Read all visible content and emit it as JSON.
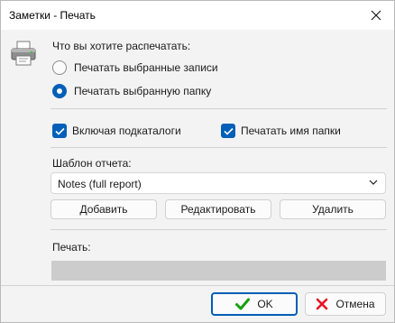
{
  "window": {
    "title": "Заметки - Печать"
  },
  "prompt": "Что вы хотите распечатать:",
  "print_mode": {
    "options": [
      {
        "label": "Печатать выбранные записи",
        "checked": false
      },
      {
        "label": "Печатать выбранную папку",
        "checked": true
      }
    ]
  },
  "options": {
    "include_subfolders": {
      "label": "Включая подкаталоги",
      "checked": true
    },
    "print_folder_name": {
      "label": "Печатать имя папки",
      "checked": true
    }
  },
  "template": {
    "label": "Шаблон отчета:",
    "selected": "Notes (full report)",
    "buttons": {
      "add": "Добавить",
      "edit": "Редактировать",
      "delete": "Удалить"
    }
  },
  "progress": {
    "label": "Печать:",
    "value": 0
  },
  "footer": {
    "ok": "OK",
    "cancel": "Отмена"
  },
  "colors": {
    "accent": "#005fb8",
    "ok_icon": "#13a10e",
    "cancel_icon": "#e81123"
  },
  "icons": [
    "close-icon",
    "printer-icon",
    "checkmark-icon",
    "chevron-down-icon",
    "ok-check-icon",
    "cancel-x-icon"
  ]
}
